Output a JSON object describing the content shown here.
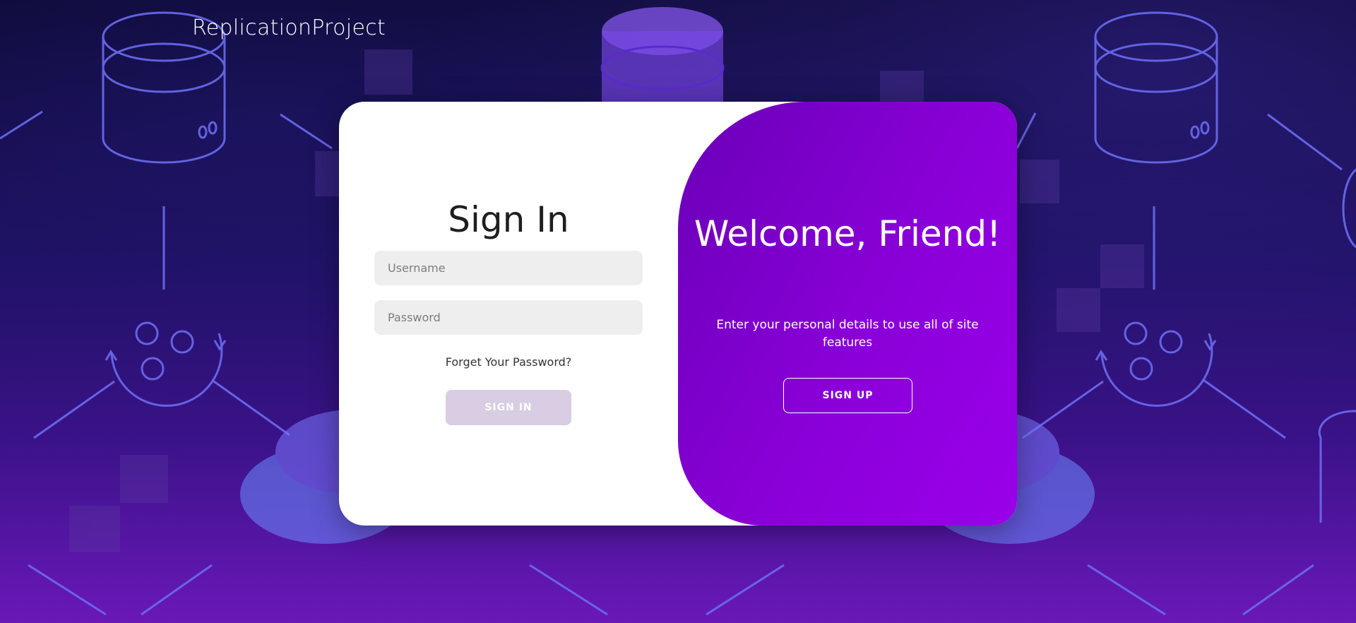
{
  "app": {
    "brand": "ReplicationProject"
  },
  "signin": {
    "title": "Sign In",
    "username_placeholder": "Username",
    "password_placeholder": "Password",
    "forgot_label": "Forget Your Password?",
    "submit_label": "SIGN IN"
  },
  "welcome": {
    "title": "Welcome, Friend!",
    "text": "Enter your personal details to use all of site features",
    "signup_label": "SIGN UP"
  },
  "colors": {
    "accent": "#8a00d8",
    "signin_button": "#d8cde2",
    "input_bg": "#eeeeee"
  },
  "icons": [
    "database-icon",
    "gears-sync-icon",
    "database-stack-icon"
  ]
}
